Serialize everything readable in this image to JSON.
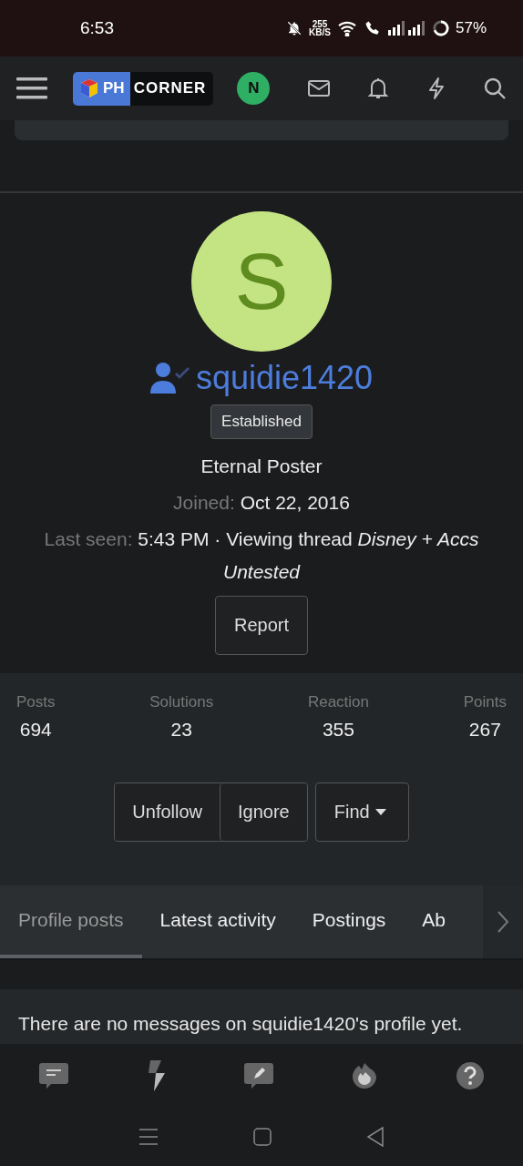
{
  "status_bar": {
    "time": "6:53",
    "speed_value": "255",
    "speed_unit": "KB/S",
    "battery": "57%"
  },
  "header": {
    "logo": {
      "left": "PH",
      "right": "CORNER"
    },
    "user_avatar": "N"
  },
  "profile": {
    "avatar_letter": "S",
    "username": "squidie1420",
    "verified": true,
    "banner": "Established",
    "title": "Eternal Poster",
    "joined_label": "Joined:",
    "joined": "Oct 22, 2016",
    "last_seen_label": "Last seen:",
    "last_seen": "5:43 PM · Viewing thread *Disney + Accs Untested*",
    "report": "Report"
  },
  "stats": [
    {
      "label": "Posts",
      "value": "694"
    },
    {
      "label": "Solutions",
      "value": "23"
    },
    {
      "label": "Reaction",
      "value": "355"
    },
    {
      "label": "Points",
      "value": "267"
    }
  ],
  "actions": {
    "group": [
      "Unfollow",
      "Ignore"
    ],
    "find": "Find"
  },
  "tabs": [
    {
      "label": "Profile posts",
      "selected": true
    },
    {
      "label": "Latest activity",
      "selected": false
    },
    {
      "label": "Postings",
      "selected": false
    },
    {
      "label": "Ab",
      "selected": false
    }
  ],
  "message": "There are no messages on squidie1420's profile yet."
}
